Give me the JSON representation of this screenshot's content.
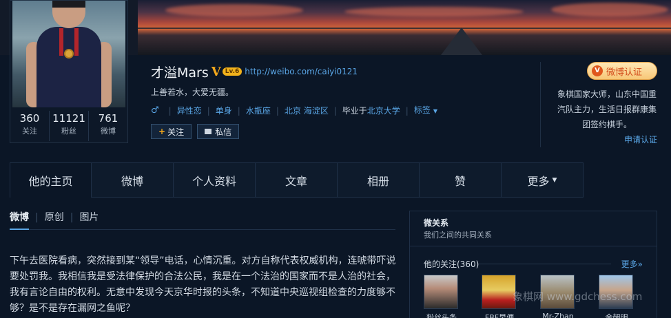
{
  "profile": {
    "name": "才溢Mars",
    "v_mark": "V",
    "level_badge": "Lv.6",
    "url": "http://weibo.com/caiyi0121",
    "motto": "上善若水，大爱无疆。",
    "gender_icon": "♂",
    "tags": [
      "异性恋",
      "单身",
      "水瓶座",
      "北京 海淀区"
    ],
    "education_prefix": "毕业于",
    "education": "北京大学",
    "tag_label": "标签",
    "follow_label": "关注",
    "message_label": "私信"
  },
  "stats": [
    {
      "num": "360",
      "label": "关注"
    },
    {
      "num": "11121",
      "label": "粉丝"
    },
    {
      "num": "761",
      "label": "微博"
    }
  ],
  "verify": {
    "badge_text": "微博认证",
    "badge_letter": "V",
    "description": "象棋国家大师，山东中国重汽队主力，生活日报群康集团签约棋手。",
    "apply_link": "申请认证"
  },
  "tabs": [
    "他的主页",
    "微博",
    "个人资料",
    "文章",
    "相册",
    "赞",
    "更多"
  ],
  "feed_tabs": [
    "微博",
    "原创",
    "图片"
  ],
  "post": {
    "text": "下午去医院看病，突然接到某“领导”电话，心情沉重。对方自称代表权威机构，连唬带吓说要处罚我。我相信我是受法律保护的合法公民，我是在一个法治的国家而不是人治的社会，我有言论自由的权利。无意中发现今天京华时报的头条，不知道中央巡视组检查的力度够不够？是不是存在漏网之鱼呢？"
  },
  "side": {
    "title": "微关系",
    "subtitle": "我们之间的共同关系",
    "follow_title": "他的关注(360)",
    "more": "更多»",
    "friends": [
      "粉丝头条",
      "FBF早便",
      "Mr-Zhan",
      "金朝明"
    ]
  },
  "watermark": "象棋网 www.gdchess.com",
  "colors": {
    "background": "#0b1626",
    "link": "#5aa6e6",
    "accent": "#f2a71b",
    "verify_badge": "#f7c777"
  }
}
